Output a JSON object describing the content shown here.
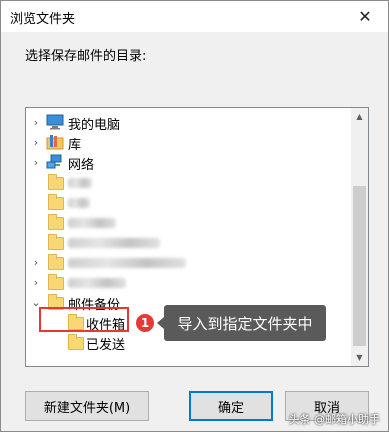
{
  "window": {
    "title": "浏览文件夹",
    "close_glyph": "✕"
  },
  "prompt": "选择保存邮件的目录:",
  "tree": {
    "items": [
      {
        "label": "我的电脑",
        "icon": "computer-icon",
        "expander": "›"
      },
      {
        "label": "库",
        "icon": "library-icon",
        "expander": "›"
      },
      {
        "label": "网络",
        "icon": "network-icon",
        "expander": "›"
      },
      {
        "label": "",
        "icon": "folder-icon",
        "expander": ""
      },
      {
        "label": "",
        "icon": "folder-icon",
        "expander": ""
      },
      {
        "label": "",
        "icon": "folder-icon",
        "expander": ""
      },
      {
        "label": "",
        "icon": "folder-icon",
        "expander": ""
      },
      {
        "label": "",
        "icon": "folder-icon",
        "expander": "›"
      },
      {
        "label": "",
        "icon": "folder-icon",
        "expander": "›"
      },
      {
        "label": "邮件备份",
        "icon": "folder-icon",
        "expander": "⌄"
      },
      {
        "label": "收件箱",
        "icon": "folder-icon",
        "expander": ""
      },
      {
        "label": "已发送",
        "icon": "folder-icon",
        "expander": ""
      }
    ]
  },
  "annotation": {
    "badge": "1",
    "callout": "导入到指定文件夹中",
    "highlight_color": "#e53935"
  },
  "buttons": {
    "new_folder": "新建文件夹(M)",
    "ok": "确定",
    "cancel": "取消"
  },
  "watermark": "头条 @邮箱小助手",
  "colors": {
    "folder": "#f8d774",
    "accent": "#0078d7",
    "callout_bg": "#5a5a5a"
  }
}
